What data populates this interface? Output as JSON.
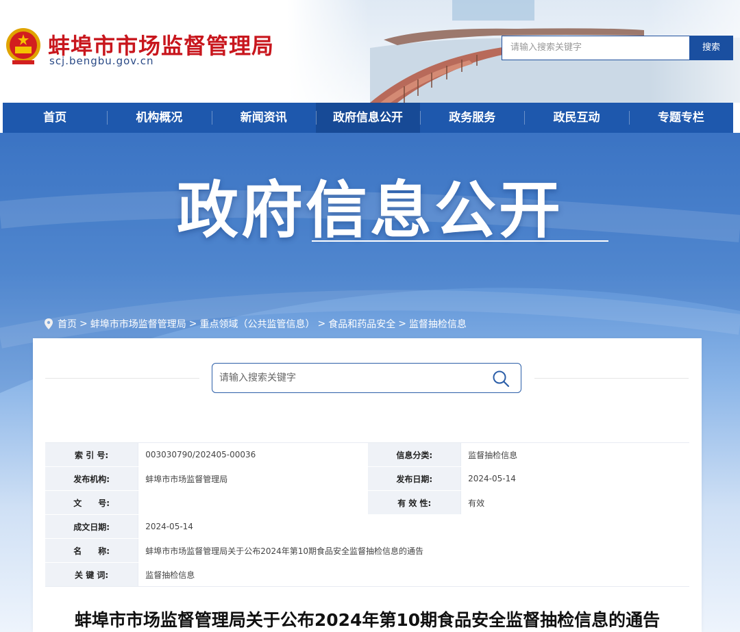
{
  "header": {
    "site_name": "蚌埠市市场监督管理局",
    "site_domain": "scj.bengbu.gov.cn",
    "search_placeholder": "请输入搜索关键字",
    "search_button": "搜索"
  },
  "nav": {
    "items": [
      "首页",
      "机构概况",
      "新闻资讯",
      "政府信息公开",
      "政务服务",
      "政民互动",
      "专题专栏"
    ],
    "active_index": 3
  },
  "banner": {
    "title": "政府信息公开"
  },
  "breadcrumb": {
    "items": [
      "首页",
      ">",
      "蚌埠市市场监督管理局",
      ">",
      "重点领域（公共监管信息）",
      ">",
      "食品和药品安全",
      ">",
      "监督抽检信息"
    ]
  },
  "content_search": {
    "placeholder": "请输入搜索关键字"
  },
  "info": {
    "index_label": "索 引 号:",
    "index_value": "003030790/202405-00036",
    "category_label": "信息分类:",
    "category_value": "监督抽检信息",
    "org_label": "发布机构:",
    "org_value": "蚌埠市市场监督管理局",
    "pubdate_label": "发布日期:",
    "pubdate_value": "2024-05-14",
    "docno_label": "文　　号:",
    "docno_value": "",
    "validity_label": "有 效 性:",
    "validity_value": "有效",
    "createdate_label": "成文日期:",
    "createdate_value": "2024-05-14",
    "name_label": "名　　称:",
    "name_value": "蚌埠市市场监督管理局关于公布2024年第10期食品安全监督抽检信息的通告",
    "keywords_label": "关 键 词:",
    "keywords_value": "监督抽检信息"
  },
  "article": {
    "title": "蚌埠市市场监督管理局关于公布2024年第10期食品安全监督抽检信息的通告"
  },
  "colors": {
    "brand_red": "#c8161d",
    "nav_blue": "#1e58ad",
    "search_blue": "#1a4fa0"
  }
}
